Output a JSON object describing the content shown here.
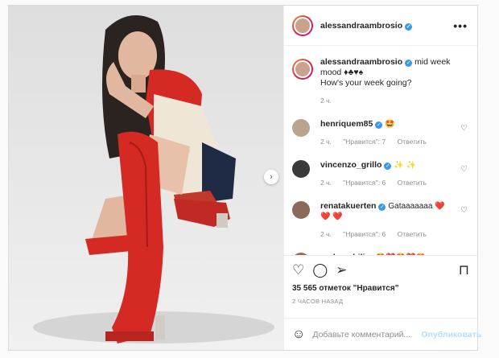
{
  "post": {
    "username": "alessandraambrosio",
    "caption_text": "mid week mood ♦♣♥♠",
    "caption_line2": "How's your week going?",
    "caption_time": "2 ч.",
    "more_icon": "•••",
    "next_icon": "›"
  },
  "comments": [
    {
      "username": "henriquem85",
      "text": "🤩",
      "time": "2 ч.",
      "likes": "\"Нравится\": 7",
      "reply": "Ответить",
      "avatar_color": "#b9a48f"
    },
    {
      "username": "vincenzo_grillo",
      "text": "✨ ✨",
      "time": "2 ч.",
      "likes": "\"Нравится\": 6",
      "reply": "Ответить",
      "avatar_color": "#3a3a3a"
    },
    {
      "username": "renatakuerten",
      "text": "Gataaaaaaa ❤️ ❤️ ❤️",
      "time": "2 ч.",
      "likes": "\"Нравится\": 6",
      "reply": "Ответить",
      "avatar_color": "#8b6a5c"
    },
    {
      "username": "andreschiliro",
      "text": "🤩❤️🤩❤️🤩",
      "avatar_color": "#a0684e"
    }
  ],
  "actions": {
    "likes": "35 565 отметок \"Нравится\"",
    "time_ago": "2 ЧАСОВ НАЗАД",
    "like_icon": "♡",
    "comment_icon": "◯",
    "share_icon": "➢",
    "save_icon": "⊓"
  },
  "add_comment": {
    "placeholder": "Добавьте комментарий...",
    "publish": "Опубликовать",
    "emoji_icon": "☺"
  },
  "colors": {
    "accent": "#3897f0",
    "boot_red": "#d42a23",
    "publish_disabled": "#b2dffc"
  }
}
